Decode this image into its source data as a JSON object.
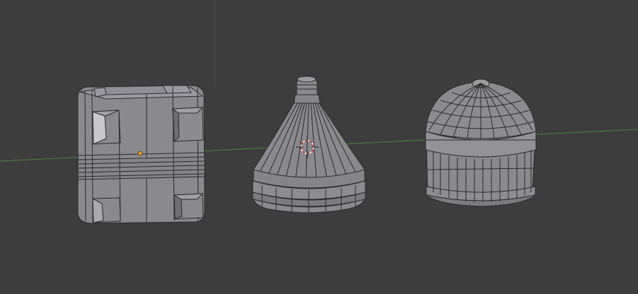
{
  "viewport": {
    "background": "#3d3d3d",
    "grid_axis_color": "#4a8a3a",
    "vertical_axis_color": "#4b4b4b",
    "mesh_fill": "#8b8b8f",
    "mesh_light": "#a3a3a8",
    "mesh_dark": "#6c6c70",
    "wire_color": "#2a2a2a",
    "origin_color": "#e0a030",
    "cursor_color": "#cc3333",
    "objects": [
      "cube-object",
      "cone-object",
      "dome-object"
    ]
  }
}
